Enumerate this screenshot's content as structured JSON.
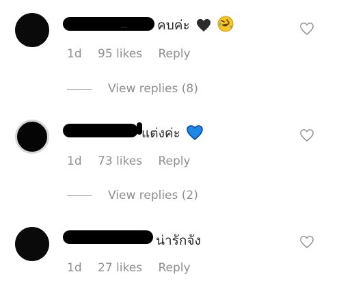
{
  "comments": [
    {
      "username_suffix": "_",
      "text": "คบค่ะ",
      "emojis": [
        "black-heart-emoji",
        "rolling-on-floor-laughing-emoji"
      ],
      "time": "1d",
      "likes": "95 likes",
      "reply_label": "Reply",
      "view_replies": "View replies (8)"
    },
    {
      "username_suffix": "",
      "text": "แต่งค่ะ",
      "emojis": [
        "blue-heart-emoji"
      ],
      "time": "1d",
      "likes": "73 likes",
      "reply_label": "Reply",
      "view_replies": "View replies (2)"
    },
    {
      "username_suffix": "",
      "text": "น่ารักจัง",
      "emojis": [],
      "time": "1d",
      "likes": "27 likes",
      "reply_label": "Reply"
    }
  ],
  "icons": {
    "like": "heart-outline-icon"
  },
  "colors": {
    "muted": "#8e8e8e",
    "text": "#262626",
    "blue_heart": "#1e88e5"
  }
}
